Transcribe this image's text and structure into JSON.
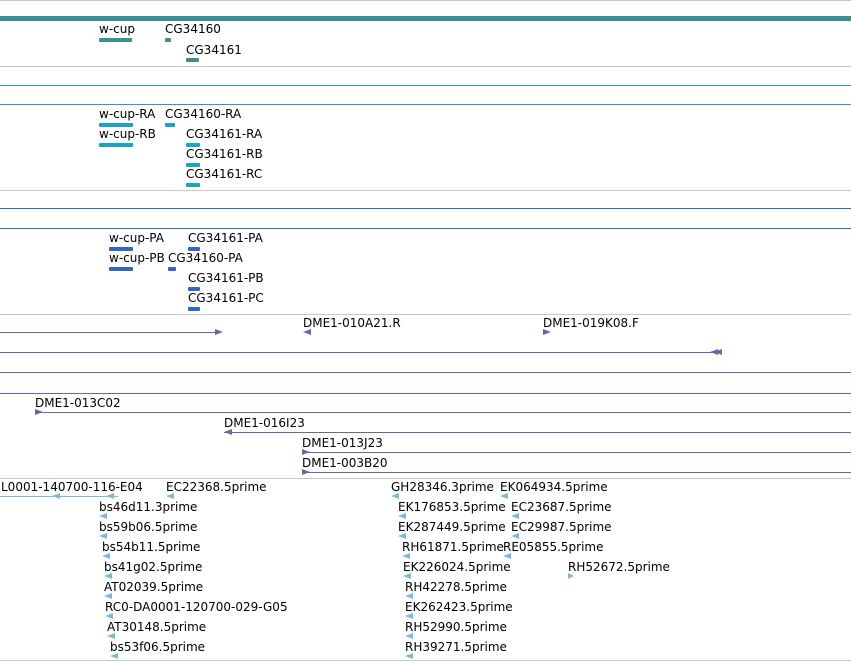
{
  "colors": {
    "gene": "#3b8f8f",
    "transcript": "#1aa3c7",
    "protein": "#2f66c9",
    "clone": "#7a5ca8",
    "est": "#7fb8df",
    "separator": "#c8c8c8"
  },
  "track_genes": {
    "labels": [
      "w-cup",
      "CG34160",
      "CG34161"
    ]
  },
  "track_transcripts": {
    "labels": [
      "w-cup-RA",
      "CG34160-RA",
      "w-cup-RB",
      "CG34161-RA",
      "CG34161-RB",
      "CG34161-RC"
    ]
  },
  "track_proteins": {
    "labels": [
      "w-cup-PA",
      "CG34161-PA",
      "w-cup-PB",
      "CG34160-PA",
      "CG34161-PB",
      "CG34161-PC"
    ]
  },
  "track_clones": {
    "labels": [
      "DME1-010A21.R",
      "DME1-019K08.F",
      "DME1-013C02",
      "DME1-016I23",
      "DME1-013J23",
      "DME1-003B20"
    ]
  },
  "track_ests": {
    "labels": [
      "L0001-140700-116-E04",
      "EC22368.5prime",
      "GH28346.3prime",
      "EK064934.5prime",
      "bs46d11.3prime",
      "EK176853.5prime",
      "EC23687.5prime",
      "bs59b06.5prime",
      "EK287449.5prime",
      "EC29987.5prime",
      "bs54b11.5prime",
      "RH61871.5prime",
      "RE05855.5prime",
      "bs41g02.5prime",
      "EK226024.5prime",
      "RH52672.5prime",
      "AT02039.5prime",
      "RH42278.5prime",
      "RC0-DA0001-120700-029-G05",
      "EK262423.5prime",
      "AT30148.5prime",
      "RH52990.5prime",
      "bs53f06.5prime",
      "RH39271.5prime"
    ]
  }
}
